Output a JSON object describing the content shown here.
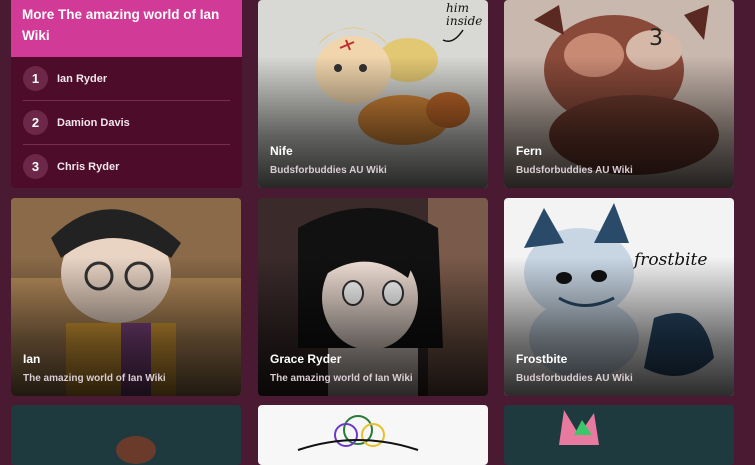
{
  "sidebar": {
    "title": "More The amazing world of Ian Wiki",
    "items": [
      {
        "rank": "1",
        "name": "Ian Ryder"
      },
      {
        "rank": "2",
        "name": "Damion Davis"
      },
      {
        "rank": "3",
        "name": "Chris Ryder"
      }
    ]
  },
  "cards": [
    {
      "title": "Nife",
      "wiki": "Budsforbuddies AU Wiki",
      "art_text": "him inside"
    },
    {
      "title": "Fern",
      "wiki": "Budsforbuddies AU Wiki"
    },
    {
      "title": "Ian",
      "wiki": "The amazing world of Ian Wiki"
    },
    {
      "title": "Grace Ryder",
      "wiki": "The amazing world of Ian Wiki"
    },
    {
      "title": "Frostbite",
      "wiki": "Budsforbuddies AU Wiki",
      "art_text": "frostbite"
    }
  ],
  "colors": {
    "background": "#4a1a33",
    "header_accent": "#d13a97",
    "panel": "#4c0c2a"
  }
}
